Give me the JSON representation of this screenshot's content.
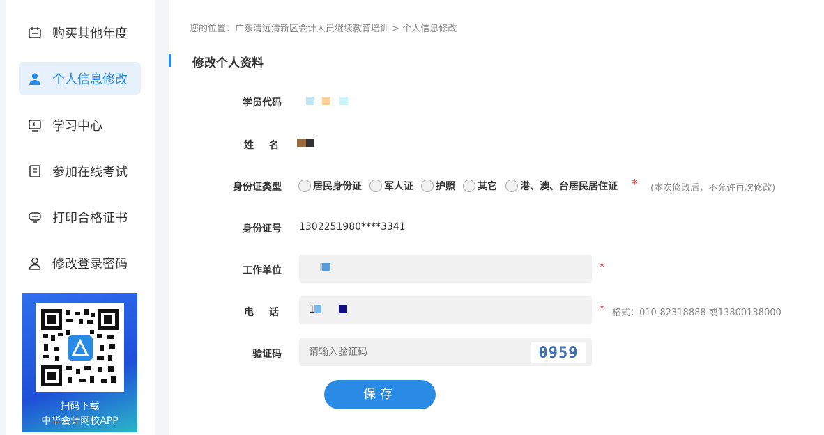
{
  "sidebar": {
    "items": [
      {
        "label": "购买其他年度",
        "icon": "calendar-icon"
      },
      {
        "label": "个人信息修改",
        "icon": "user-icon"
      },
      {
        "label": "学习中心",
        "icon": "monitor-icon"
      },
      {
        "label": "参加在线考试",
        "icon": "exam-icon"
      },
      {
        "label": "打印合格证书",
        "icon": "certificate-icon"
      },
      {
        "label": "修改登录密码",
        "icon": "user-lock-icon"
      }
    ],
    "qr": {
      "line1": "扫码下载",
      "line2": "中华会计网校APP"
    }
  },
  "breadcrumb": {
    "prefix": "您的位置：",
    "site": "广东清远清新区会计人员继续教育培训",
    "sep": ">",
    "current": "个人信息修改"
  },
  "form": {
    "title": "修改个人资料",
    "student_code_label": "学员代码",
    "name_label": "姓　名",
    "id_type_label": "身份证类型",
    "id_types": [
      "居民身份证",
      "军人证",
      "护照",
      "其它",
      "港、澳、台居民居住证"
    ],
    "id_type_note": "(本次修改后，不允许再次修改)",
    "id_number_label": "身份证号",
    "id_number_value": "1302251980****3341",
    "work_unit_label": "工作单位",
    "phone_label": "电　话",
    "phone_prefix": "1",
    "phone_hint": "格式：010-82318888 或13800138000",
    "captcha_label": "验证码",
    "captcha_placeholder": "请输入验证码",
    "captcha_value": "0959",
    "required_mark": "*",
    "save_label": "保存"
  },
  "colors": {
    "accent": "#2a8be6",
    "active_bg": "#e6f1fc",
    "required": "#e54545"
  }
}
